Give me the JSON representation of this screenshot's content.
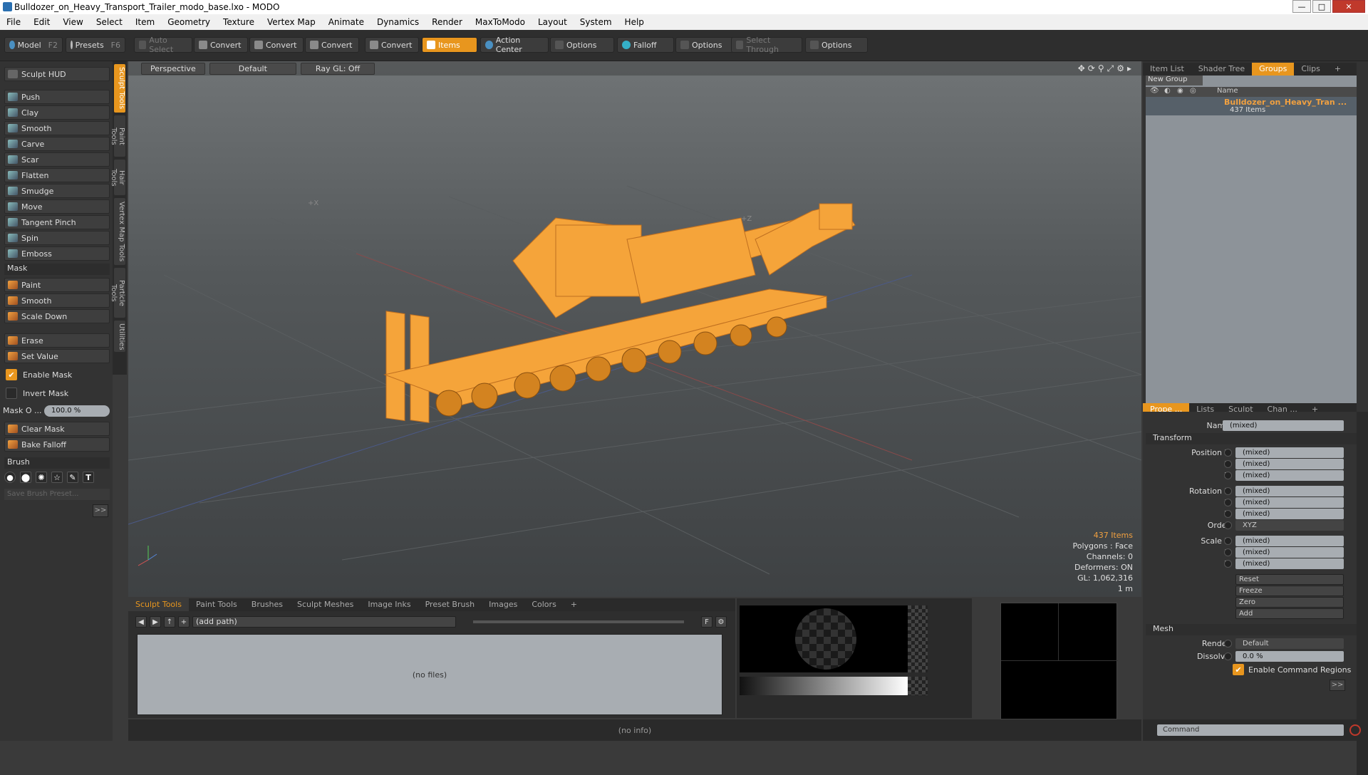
{
  "window": {
    "title": "Bulldozer_on_Heavy_Transport_Trailer_modo_base.lxo - MODO",
    "min": "—",
    "max": "□",
    "close": "✕"
  },
  "menu": [
    "File",
    "Edit",
    "View",
    "Select",
    "Item",
    "Geometry",
    "Texture",
    "Vertex Map",
    "Animate",
    "Dynamics",
    "Render",
    "MaxToModo",
    "Layout",
    "System",
    "Help"
  ],
  "toolbar": {
    "model": "Model",
    "model_key": "F2",
    "presets": "Presets",
    "presets_key": "F6",
    "auto_select": "Auto Select",
    "convert": "Convert",
    "items": "Items",
    "action_center": "Action Center",
    "options": "Options",
    "falloff": "Falloff",
    "select_through": "Select Through"
  },
  "left": {
    "sculpt_hud": "Sculpt HUD",
    "tools": [
      "Push",
      "Clay",
      "Smooth",
      "Carve",
      "Scar",
      "Flatten",
      "Smudge",
      "Move",
      "Tangent Pinch",
      "Spin",
      "Emboss"
    ],
    "mask_section": "Mask",
    "mask_tools": [
      "Paint",
      "Smooth",
      "Scale Down"
    ],
    "erase": "Erase",
    "set_value": "Set Value",
    "enable_mask": "Enable Mask",
    "invert_mask": "Invert Mask",
    "mask_opacity_label": "Mask O ...",
    "mask_opacity_value": "100.0 %",
    "clear_mask": "Clear Mask",
    "bake_falloff": "Bake Falloff",
    "brush_section": "Brush",
    "save_brush": "Save Brush Preset...",
    "more": ">>"
  },
  "side_tabs": [
    "Sculpt Tools",
    "Paint Tools",
    "Hair Tools",
    "Vertex Map Tools",
    "Particle Tools",
    "Utilities"
  ],
  "viewport": {
    "perspective": "Perspective",
    "default": "Default",
    "raygl": "Ray GL: Off",
    "axis_x": "+X",
    "axis_z": "+Z",
    "stats": {
      "items": "437 Items",
      "polygons": "Polygons : Face",
      "channels": "Channels: 0",
      "deformers": "Deformers: ON",
      "gl": "GL: 1,062,316",
      "unit": "1 m"
    }
  },
  "bottom": {
    "tabs": [
      "Sculpt Tools",
      "Paint Tools",
      "Brushes",
      "Sculpt Meshes",
      "Image Inks",
      "Preset Brush",
      "Images",
      "Colors",
      "+"
    ],
    "path": "(add path)",
    "no_files": "(no files)",
    "no_info": "(no info)"
  },
  "right": {
    "top_tabs": [
      "Item List",
      "Shader Tree",
      "Groups",
      "Clips",
      "+"
    ],
    "new_group": "New Group",
    "col_name": "Name",
    "group_name": "Bulldozer_on_Heavy_Tran ...",
    "group_count": "437 Items",
    "prop_tabs": [
      "Prope ...",
      "Lists",
      "Sculpt",
      "Chan ...",
      "+"
    ],
    "name_label": "Name",
    "name_value": "(mixed)",
    "transform": "Transform",
    "position_x": "Position X",
    "y": "Y",
    "z": "Z",
    "rotation_x": "Rotation X",
    "order": "Order",
    "order_value": "XYZ",
    "scale_x": "Scale X",
    "mixed": "(mixed)",
    "reset": "Reset",
    "freeze": "Freeze",
    "zero": "Zero",
    "add": "Add",
    "mesh": "Mesh",
    "render": "Render",
    "render_value": "Default",
    "dissolve": "Dissolve",
    "dissolve_value": "0.0 %",
    "enable_cmd": "Enable Command Regions",
    "more": ">>",
    "command": "Command"
  },
  "colors": {
    "accent": "#e8961e",
    "model": "#f5a43a"
  }
}
